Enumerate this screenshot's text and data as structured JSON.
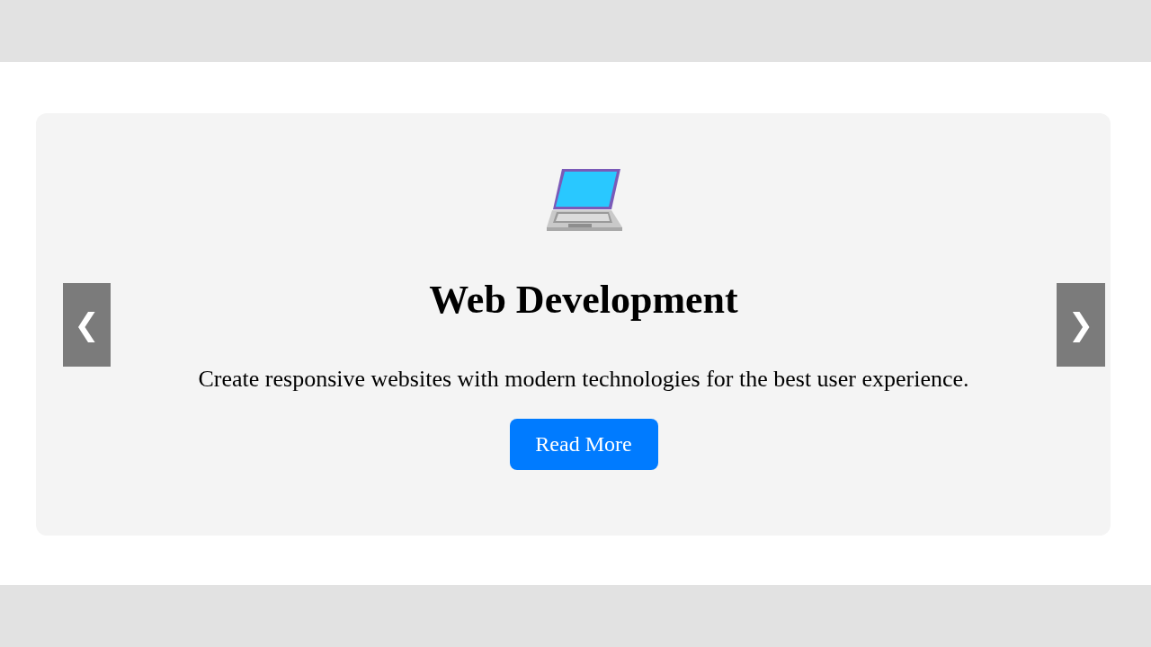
{
  "carousel": {
    "prev_label": "❮",
    "next_label": "❯",
    "slide": {
      "title": "Web Development",
      "description": "Create responsive websites with modern technologies for the best user experience.",
      "button": "Read More"
    }
  }
}
